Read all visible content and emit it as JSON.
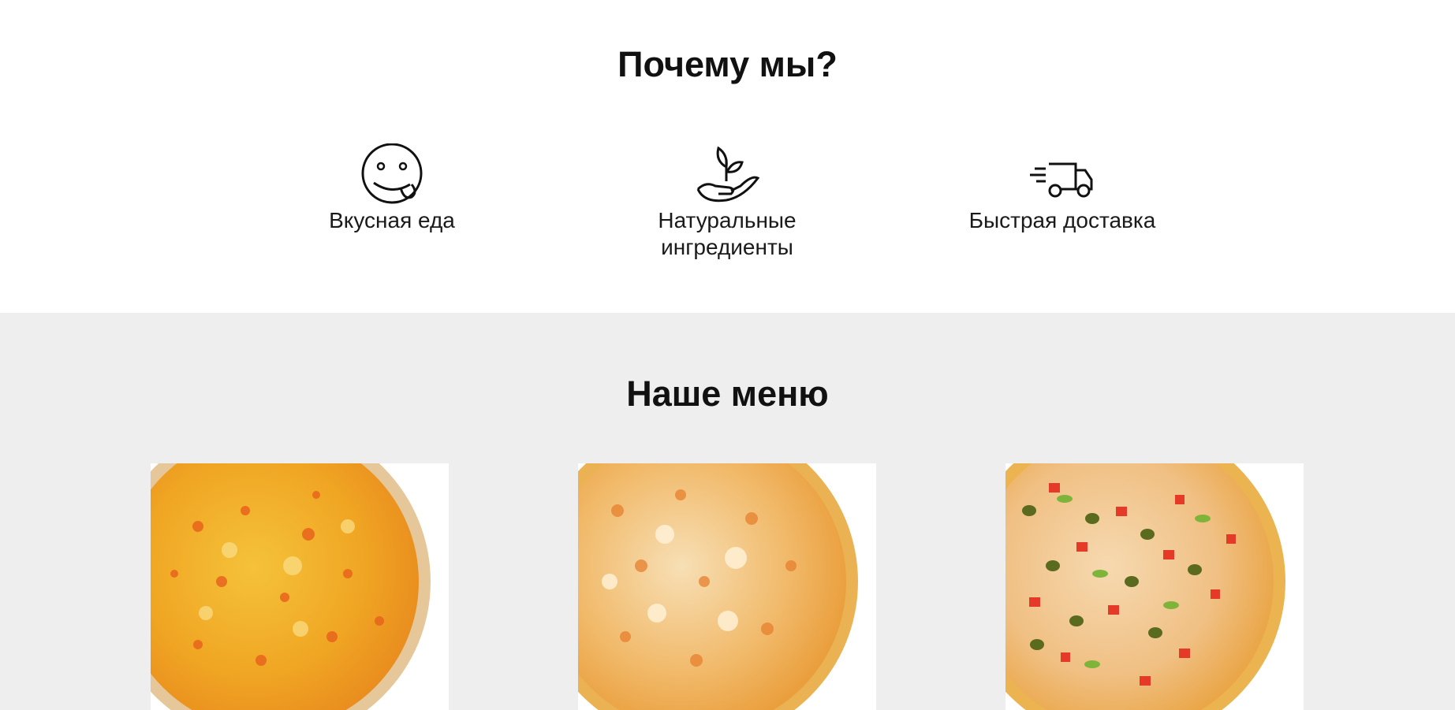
{
  "why": {
    "title": "Почему мы?",
    "features": [
      {
        "icon": "smiley-tongue-icon",
        "label": "Вкусная еда"
      },
      {
        "icon": "plant-hand-icon",
        "label": "Натуральные ингредиенты"
      },
      {
        "icon": "delivery-truck-icon",
        "label": "Быстрая доставка"
      }
    ]
  },
  "menu": {
    "title": "Наше меню",
    "items": [
      {
        "image": "pizza-cheese-image"
      },
      {
        "image": "pizza-hawaiian-image"
      },
      {
        "image": "pizza-pepper-image"
      }
    ]
  }
}
